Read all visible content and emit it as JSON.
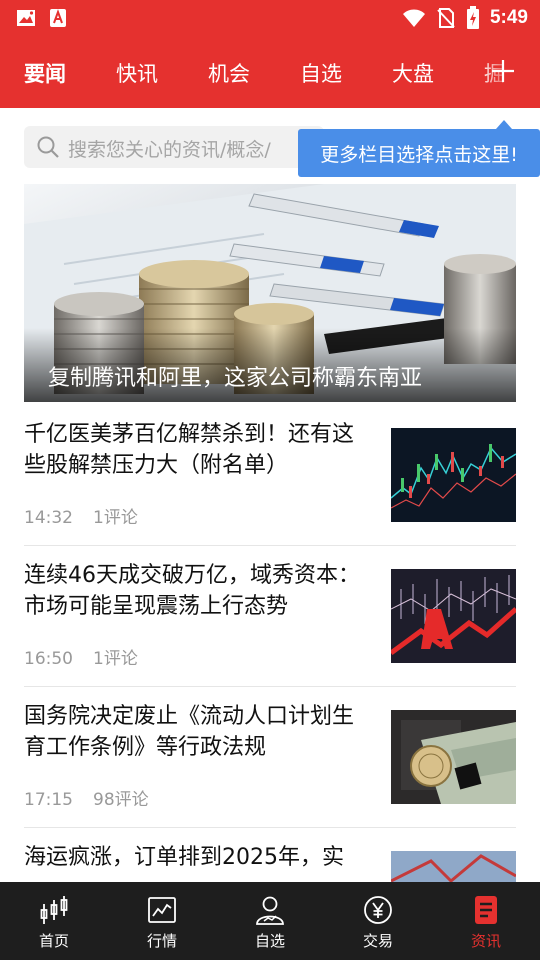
{
  "status_bar": {
    "time": "5:49"
  },
  "tabs": [
    {
      "label": "要闻",
      "active": true
    },
    {
      "label": "快讯"
    },
    {
      "label": "机会"
    },
    {
      "label": "自选"
    },
    {
      "label": "大盘"
    },
    {
      "label": "掘"
    }
  ],
  "search": {
    "placeholder": "搜索您关心的资讯/概念/"
  },
  "tooltip": {
    "text": "更多栏目选择点击这里!"
  },
  "hero": {
    "title": "复制腾讯和阿里，这家公司称霸东南亚"
  },
  "news": [
    {
      "title": "千亿医美茅百亿解禁杀到！还有这些股解禁压力大（附名单）",
      "time": "14:32",
      "comments": "1评论"
    },
    {
      "title": "连续46天成交破万亿，域秀资本：市场可能呈现震荡上行态势",
      "time": "16:50",
      "comments": "1评论"
    },
    {
      "title": "国务院决定废止《流动人口计划生育工作条例》等行政法规",
      "time": "17:15",
      "comments": "98评论"
    },
    {
      "title": "海运疯涨，订单排到2025年，实",
      "time": "",
      "comments": ""
    }
  ],
  "bottom_nav": [
    {
      "label": "首页",
      "icon": "candlestick-icon"
    },
    {
      "label": "行情",
      "icon": "chart-icon"
    },
    {
      "label": "自选",
      "icon": "user-chart-icon"
    },
    {
      "label": "交易",
      "icon": "yuan-icon"
    },
    {
      "label": "资讯",
      "icon": "news-doc-icon",
      "active": true
    }
  ],
  "colors": {
    "brand_red": "#e5312f",
    "tooltip_blue": "#4a8ee8",
    "nav_dark": "#1e1e1e"
  }
}
